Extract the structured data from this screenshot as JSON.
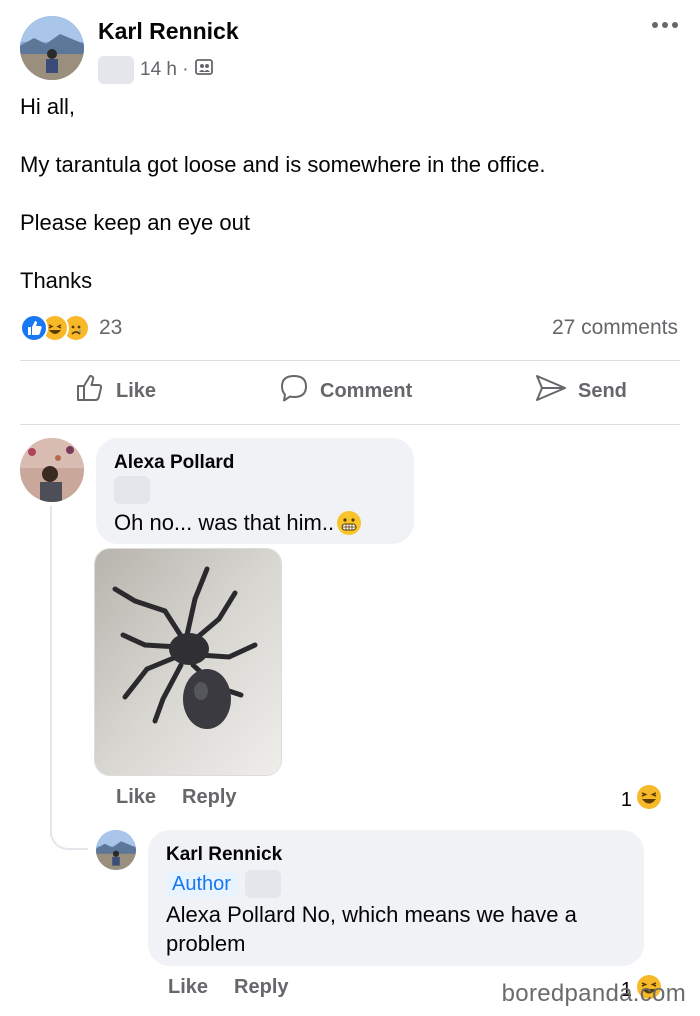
{
  "post": {
    "author": "Karl Rennick",
    "time": "14 h ·",
    "body": [
      "Hi all,",
      "My tarantula got loose and is somewhere in the office.",
      "Please keep an eye out",
      "Thanks"
    ],
    "reaction_count": "23",
    "reaction_icons": [
      "like-icon",
      "haha-icon",
      "sad-icon"
    ],
    "comments_count": "27 comments"
  },
  "actions": {
    "like": "Like",
    "comment": "Comment",
    "send": "Send"
  },
  "comments": [
    {
      "author": "Alexa Pollard",
      "text": "Oh no... was that him..",
      "emoji": "grimacing-face-icon",
      "like": "Like",
      "reply": "Reply",
      "reaction_count": "1",
      "reaction_icon": "haha-icon"
    },
    {
      "author": "Karl Rennick",
      "badge": "Author",
      "text": "Alexa Pollard No, which means we have a problem",
      "like": "Like",
      "reply": "Reply",
      "reaction_count": "1",
      "reaction_icon": "haha-icon"
    }
  ],
  "watermark": "boredpanda.com",
  "colors": {
    "accent": "#1877f2",
    "muted_text": "#65676b",
    "bubble": "#f0f2f5"
  }
}
